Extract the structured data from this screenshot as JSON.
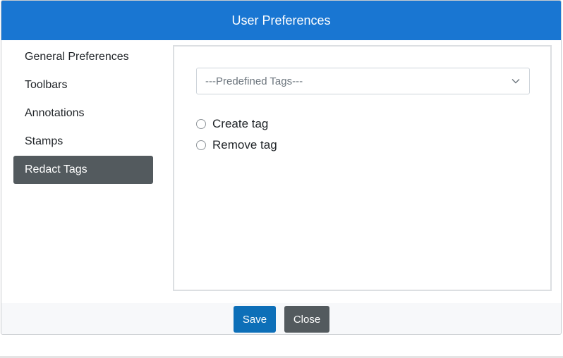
{
  "dialog": {
    "title": "User Preferences"
  },
  "sidebar": {
    "items": [
      {
        "label": "General Preferences",
        "active": false
      },
      {
        "label": "Toolbars",
        "active": false
      },
      {
        "label": "Annotations",
        "active": false
      },
      {
        "label": "Stamps",
        "active": false
      },
      {
        "label": "Redact Tags",
        "active": true
      }
    ]
  },
  "content": {
    "tag_select": {
      "selected": "---Predefined Tags---",
      "icon": "chevron-down-icon"
    },
    "radios": [
      {
        "label": "Create tag",
        "checked": false
      },
      {
        "label": "Remove tag",
        "checked": false
      }
    ]
  },
  "footer": {
    "save_label": "Save",
    "close_label": "Close"
  },
  "colors": {
    "header_bg": "#1976d2",
    "active_item_bg": "#535a5e",
    "save_bg": "#0d6fb8",
    "close_bg": "#535a5e"
  }
}
